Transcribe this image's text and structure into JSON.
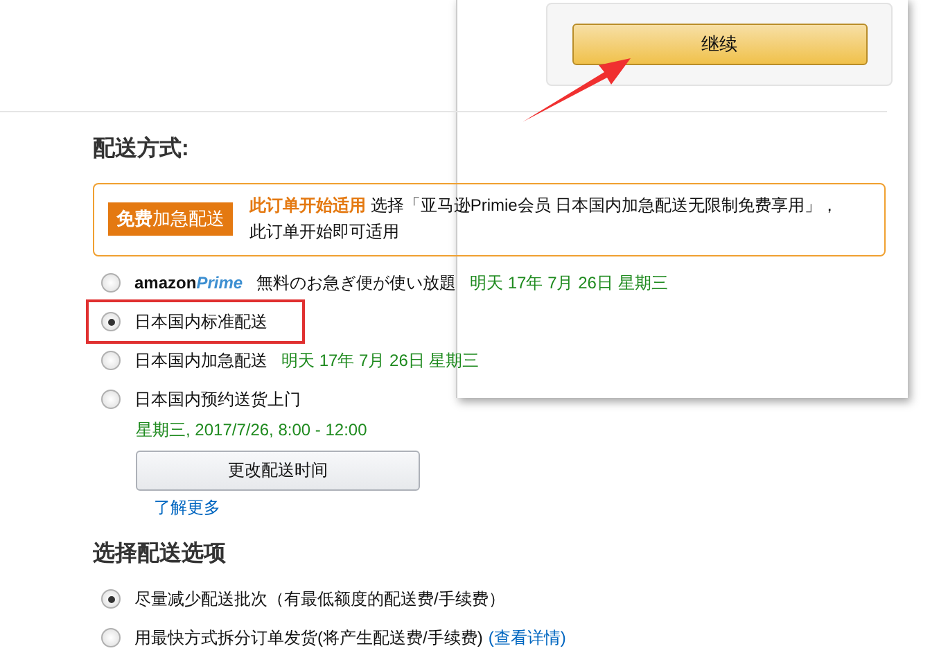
{
  "continue_panel": {
    "button": "继续"
  },
  "delivery_method": {
    "title": "配送方式:",
    "promo": {
      "badge_strong": "免费",
      "badge_text": "加急配送",
      "title": "此订单开始适用",
      "text": "选择「亚马逊Primie会员 日本国内加急配送无限制免费享用」，此订单开始即可适用"
    },
    "options": [
      {
        "kind": "prime",
        "logo_word": "amazon",
        "logo_brand": "Prime",
        "label": "無料のお急ぎ便が使い放題",
        "date": "明天 17年 7月 26日 星期三",
        "selected": false,
        "highlighted": false
      },
      {
        "kind": "plain",
        "label": "日本国内标准配送",
        "selected": true,
        "highlighted": true
      },
      {
        "kind": "plain",
        "label": "日本国内加急配送",
        "date": "明天 17年 7月 26日 星期三",
        "selected": false,
        "highlighted": false
      },
      {
        "kind": "scheduled",
        "label": "日本国内预约送货上门",
        "slot": "星期三, 2017/7/26, 8:00 - 12:00",
        "button": "更改配送时间",
        "link": "了解更多",
        "selected": false,
        "highlighted": false
      }
    ]
  },
  "delivery_options": {
    "title": "选择配送选项",
    "options": [
      {
        "label": "尽量减少配送批次（有最低额度的配送费/手续费）",
        "selected": true
      },
      {
        "label": "用最快方式拆分订单发货(将产生配送费/手续费)",
        "link": "(查看详情)",
        "selected": false
      }
    ]
  }
}
